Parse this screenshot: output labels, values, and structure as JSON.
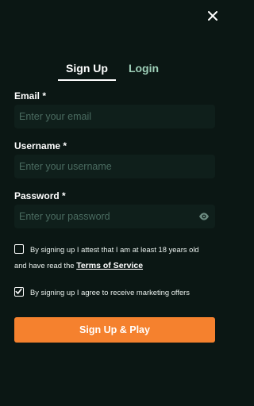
{
  "header": {
    "close_icon": "close-icon"
  },
  "tabs": [
    {
      "label": "Sign Up",
      "active": true
    },
    {
      "label": "Login",
      "active": false
    }
  ],
  "form": {
    "email": {
      "label": "Email",
      "required_mark": "*",
      "placeholder": "Enter your email",
      "value": ""
    },
    "username": {
      "label": "Username",
      "required_mark": "*",
      "placeholder": "Enter your username",
      "value": ""
    },
    "password": {
      "label": "Password",
      "required_mark": "*",
      "placeholder": "Enter your password",
      "value": "",
      "toggle_icon": "eye-icon"
    }
  },
  "consents": {
    "age": {
      "checked": false,
      "text_line1": "By signing up I attest that I am at least 18 years old",
      "text_line2": "and have read the",
      "link_text": "Terms of Service"
    },
    "marketing": {
      "checked": true,
      "text": "By signing up I agree to receive marketing offers"
    }
  },
  "submit": {
    "label": "Sign Up & Play"
  },
  "colors": {
    "background": "#0b1714",
    "input_background": "#0f1f1b",
    "accent": "#f5812e",
    "inactive_tab": "#9fd0b9",
    "placeholder": "#4a6b60"
  }
}
